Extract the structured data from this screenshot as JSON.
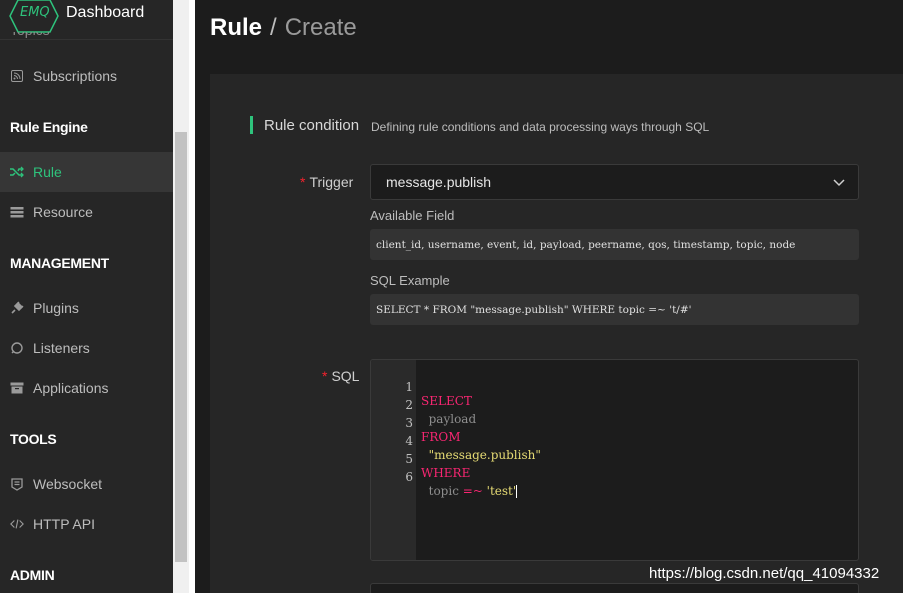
{
  "brand": {
    "logo_text": "EMQ",
    "title": "Dashboard"
  },
  "sidebar": {
    "cut_item": "Topics",
    "items": [
      {
        "label": "Subscriptions",
        "icon": "rss-icon",
        "active": false
      },
      {
        "label": "Rule",
        "icon": "shuffle-icon",
        "active": true
      },
      {
        "label": "Resource",
        "icon": "server-icon",
        "active": false
      },
      {
        "label": "Plugins",
        "icon": "plug-icon",
        "active": false
      },
      {
        "label": "Listeners",
        "icon": "circle-icon",
        "active": false
      },
      {
        "label": "Applications",
        "icon": "box-icon",
        "active": false
      },
      {
        "label": "Websocket",
        "icon": "websocket-icon",
        "active": false
      },
      {
        "label": "HTTP API",
        "icon": "code-icon",
        "active": false
      }
    ],
    "sections": [
      "Rule Engine",
      "MANAGEMENT",
      "TOOLS",
      "ADMIN"
    ]
  },
  "breadcrumb": {
    "first": "Rule",
    "separator": "/",
    "second": "Create"
  },
  "rule_condition": {
    "title": "Rule condition",
    "description": "Defining rule conditions and data processing ways through SQL"
  },
  "form": {
    "trigger_label": "Trigger",
    "trigger_value": "message.publish",
    "available_field_label": "Available Field",
    "available_field_value": "client_id, username, event, id, payload, peername, qos, timestamp, topic, node",
    "sql_example_label": "SQL Example",
    "sql_example_value": "SELECT * FROM \"message.publish\" WHERE topic =~ 't/#'",
    "sql_label": "SQL",
    "required_mark": "*"
  },
  "editor": {
    "lines": [
      {
        "n": "1",
        "keyword": "SELECT",
        "text": "",
        "str": ""
      },
      {
        "n": "2",
        "keyword": "",
        "text": "  payload",
        "str": ""
      },
      {
        "n": "3",
        "keyword": "FROM",
        "text": "",
        "str": ""
      },
      {
        "n": "4",
        "keyword": "",
        "text": "  ",
        "str": "\"message.publish\""
      },
      {
        "n": "5",
        "keyword": "WHERE",
        "text": "",
        "str": ""
      },
      {
        "n": "6",
        "keyword": "",
        "text": "  topic ",
        "op": "=~",
        "str": " 'test'"
      }
    ]
  },
  "colors": {
    "accent": "#2ec37c",
    "required": "#f5222d",
    "keyword": "#f92672",
    "string": "#e6db74"
  },
  "watermark": "https://blog.csdn.net/qq_41094332"
}
